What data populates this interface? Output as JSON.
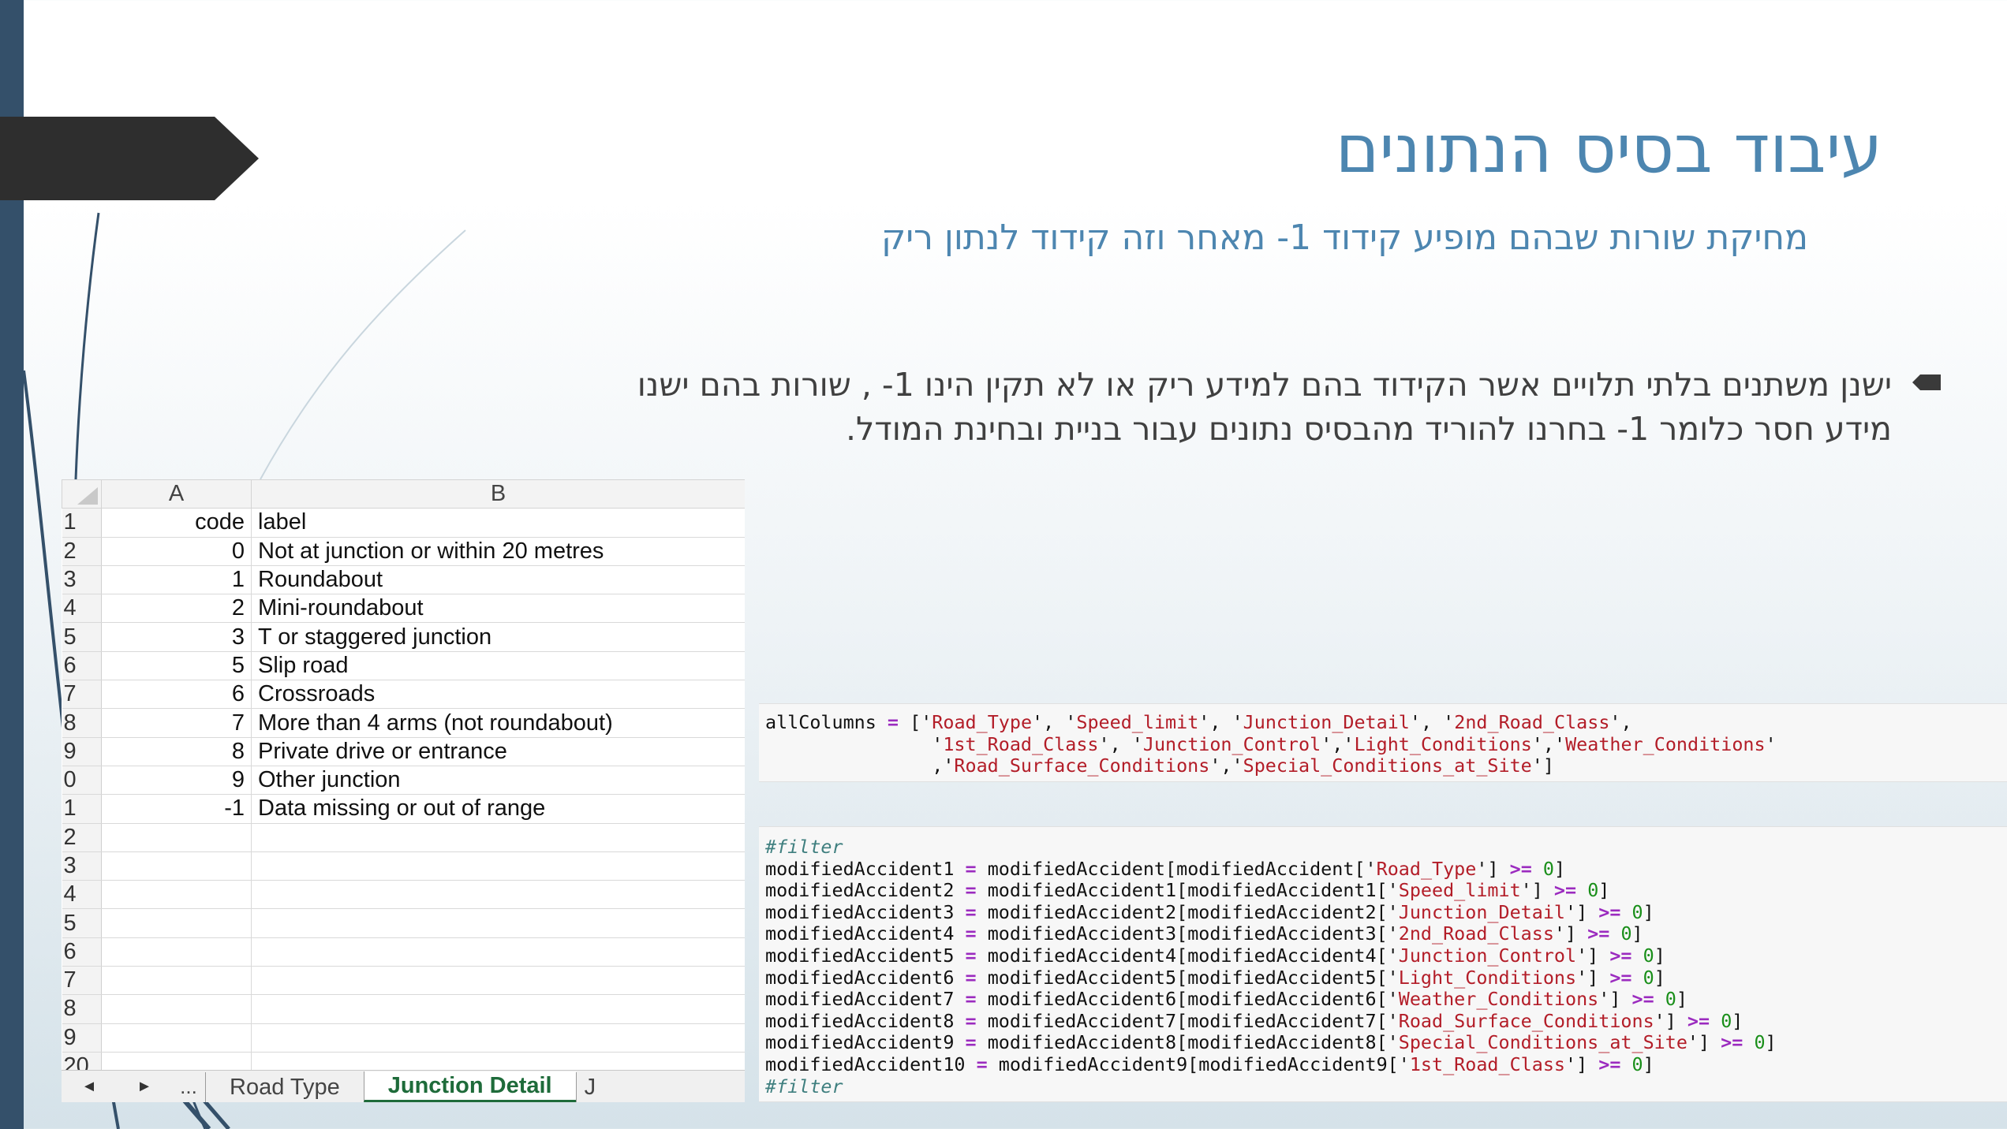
{
  "slide": {
    "title": "עיבוד בסיס הנתונים",
    "subtitle": "מחיקת שורות שבהם מופיע קידוד 1- מאחר וזה קידוד לנתון ריק",
    "bullet": {
      "line1": "ישנן משתנים בלתי תלויים אשר הקידוד בהם למידע ריק או לא תקין הינו 1- , שורות בהם ישנו",
      "line2": "מידע חסר כלומר 1- בחרנו להוריד מהבסיס נתונים עבור בניית ובחינת המודל."
    }
  },
  "spreadsheet": {
    "col_headers": [
      "A",
      "B"
    ],
    "row_numbers": [
      "1",
      "2",
      "3",
      "4",
      "5",
      "6",
      "7",
      "8",
      "9",
      "0",
      "1",
      "2",
      "3",
      "4",
      "5",
      "6",
      "7",
      "8",
      "9",
      "20"
    ],
    "rows": [
      {
        "a": "code",
        "b": "label"
      },
      {
        "a": "0",
        "b": "Not at junction or within 20 metres"
      },
      {
        "a": "1",
        "b": "Roundabout"
      },
      {
        "a": "2",
        "b": "Mini-roundabout"
      },
      {
        "a": "3",
        "b": "T or staggered junction"
      },
      {
        "a": "5",
        "b": "Slip road"
      },
      {
        "a": "6",
        "b": "Crossroads"
      },
      {
        "a": "7",
        "b": "More than 4 arms (not roundabout)"
      },
      {
        "a": "8",
        "b": "Private drive or entrance"
      },
      {
        "a": "9",
        "b": "Other junction"
      },
      {
        "a": "-1",
        "b": "Data missing or out of range"
      },
      {
        "a": "",
        "b": ""
      },
      {
        "a": "",
        "b": ""
      },
      {
        "a": "",
        "b": ""
      },
      {
        "a": "",
        "b": ""
      },
      {
        "a": "",
        "b": ""
      },
      {
        "a": "",
        "b": ""
      },
      {
        "a": "",
        "b": ""
      },
      {
        "a": "",
        "b": ""
      },
      {
        "a": "",
        "b": ""
      }
    ],
    "tabs": {
      "prev": "◄",
      "next": "►",
      "more": "...",
      "sheets": [
        "Road Type",
        "Junction Detail",
        "J"
      ],
      "active": "Junction Detail"
    }
  },
  "code": {
    "columns_var": "allColumns",
    "columns": [
      "Road_Type",
      "Speed_limit",
      "Junction_Detail",
      "2nd_Road_Class",
      "1st_Road_Class",
      "Junction_Control",
      "Light_Conditions",
      "Weather_Conditions",
      "Road_Surface_Conditions",
      "Special_Conditions_at_Site"
    ],
    "filter_comment": "#filter",
    "filter_lines": [
      {
        "target": "modifiedAccident1",
        "source": "modifiedAccident",
        "column": "Road_Type"
      },
      {
        "target": "modifiedAccident2",
        "source": "modifiedAccident1",
        "column": "Speed_limit"
      },
      {
        "target": "modifiedAccident3",
        "source": "modifiedAccident2",
        "column": "Junction_Detail"
      },
      {
        "target": "modifiedAccident4",
        "source": "modifiedAccident3",
        "column": "2nd_Road_Class"
      },
      {
        "target": "modifiedAccident5",
        "source": "modifiedAccident4",
        "column": "Junction_Control"
      },
      {
        "target": "modifiedAccident6",
        "source": "modifiedAccident5",
        "column": "Light_Conditions"
      },
      {
        "target": "modifiedAccident7",
        "source": "modifiedAccident6",
        "column": "Weather_Conditions"
      },
      {
        "target": "modifiedAccident8",
        "source": "modifiedAccident7",
        "column": "Road_Surface_Conditions"
      },
      {
        "target": "modifiedAccident9",
        "source": "modifiedAccident8",
        "column": "Special_Conditions_at_Site"
      },
      {
        "target": "modifiedAccident10",
        "source": "modifiedAccident9",
        "column": "1st_Road_Class"
      }
    ],
    "operator": ">=",
    "threshold": "0"
  },
  "colors": {
    "accent": "#4d86b0",
    "left_bar": "#34506a",
    "arrow": "#2e2e2e",
    "active_tab": "#1e6b3a"
  }
}
